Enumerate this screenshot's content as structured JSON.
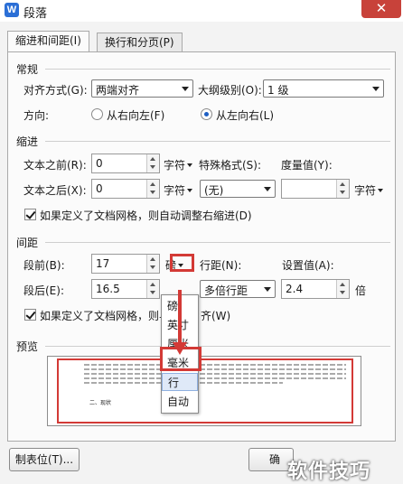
{
  "window": {
    "title": "段落",
    "close_glyph": "✕",
    "icon": "wps-logo-icon",
    "icon_letter": "W"
  },
  "tabs": [
    {
      "label": "缩进和间距(I)",
      "active": true
    },
    {
      "label": "换行和分页(P)",
      "active": false
    }
  ],
  "general": {
    "section_label": "常规",
    "alignment_label": "对齐方式(G):",
    "alignment_value": "两端对齐",
    "outline_label": "大纲级别(O):",
    "outline_value": "1 级",
    "direction_label": "方向:",
    "direction_options": [
      {
        "label": "从右向左(F)",
        "selected": false
      },
      {
        "label": "从左向右(L)",
        "selected": true
      }
    ]
  },
  "indent": {
    "section_label": "缩进",
    "before_label": "文本之前(R):",
    "before_value": "0",
    "before_unit": "字符",
    "after_label": "文本之后(X):",
    "after_value": "0",
    "after_unit": "字符",
    "special_label": "特殊格式(S):",
    "special_value": "(无)",
    "measure_label": "度量值(Y):",
    "measure_value": "",
    "measure_unit": "字符",
    "grid_checkbox_label": "如果定义了文档网格，则自动调整右缩进(D)",
    "grid_checkbox_checked": true
  },
  "spacing": {
    "section_label": "间距",
    "before_label": "段前(B):",
    "before_value": "17",
    "before_unit": "磅",
    "after_label": "段后(E):",
    "after_value": "16.5",
    "line_spacing_label": "行距(N):",
    "line_spacing_value": "多倍行距",
    "set_value_label": "设置值(A):",
    "set_value": "2.4",
    "set_value_unit": "倍",
    "grid_checkbox_label_a": "如果定义了文档网格，则与",
    "grid_checkbox_label_b": "齐(W)",
    "grid_checkbox_checked": true
  },
  "unit_dropdown": {
    "options": [
      "磅",
      "英寸",
      "厘米",
      "毫米",
      "行",
      "自动"
    ],
    "selected": "行"
  },
  "preview": {
    "section_label": "预览",
    "sample_text": "二、现状"
  },
  "buttons": {
    "tabs_label": "制表位(T)...",
    "ok_label": "确"
  },
  "watermark": "软件技巧",
  "colors": {
    "accent": "#2b6fd6",
    "annotation_red": "#d33a36",
    "close_red": "#c8423a"
  }
}
